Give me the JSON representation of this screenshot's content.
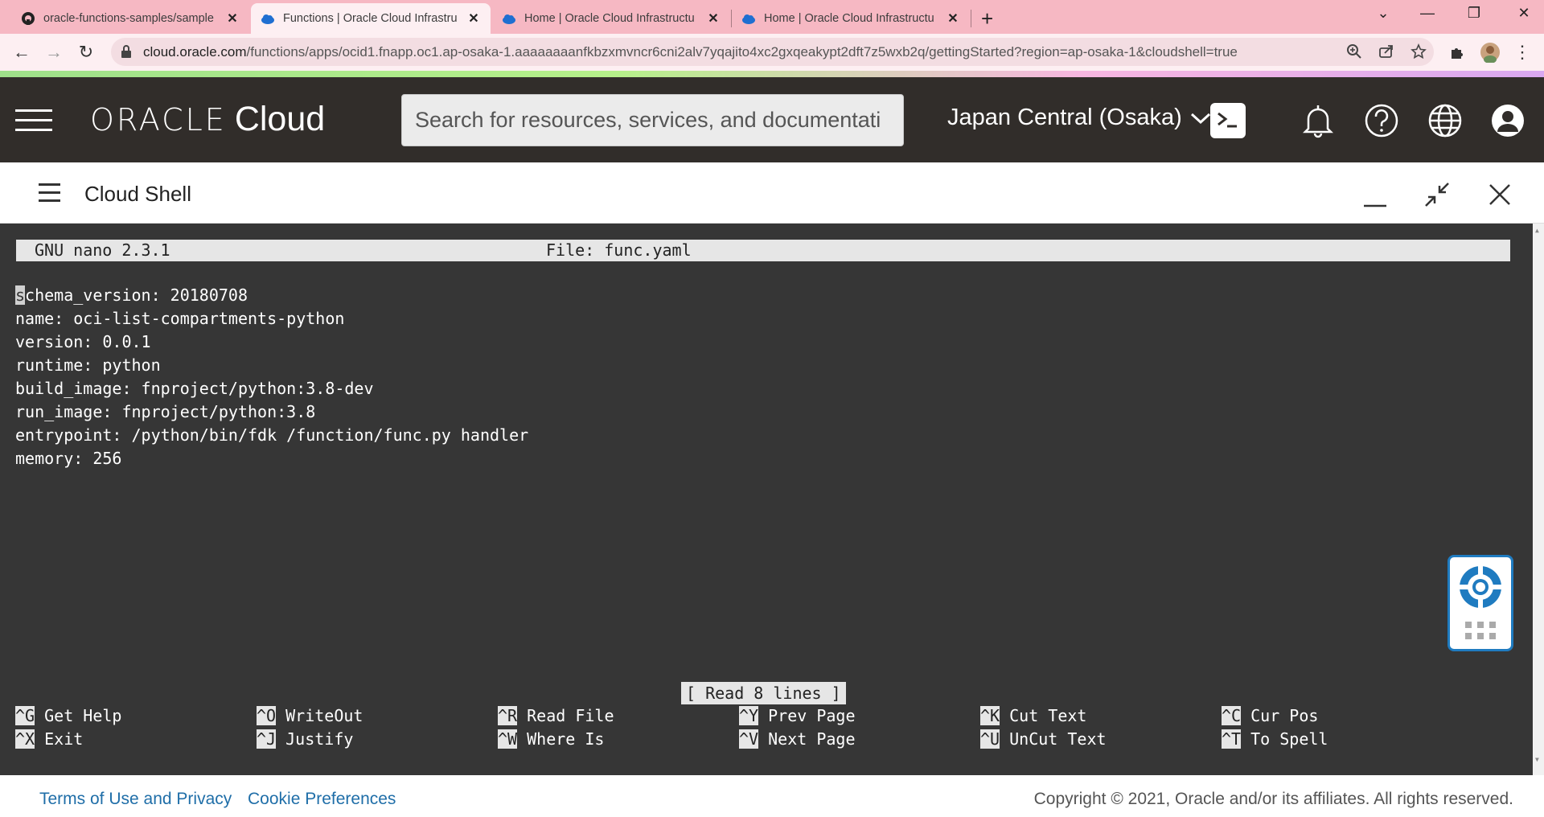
{
  "browser": {
    "tabs": [
      {
        "title": "oracle-functions-samples/sample",
        "icon": "github-icon",
        "active": false
      },
      {
        "title": "Functions | Oracle Cloud Infrastru",
        "icon": "oracle-cloud-icon",
        "active": true
      },
      {
        "title": "Home | Oracle Cloud Infrastructu",
        "icon": "oracle-cloud-icon",
        "active": false
      },
      {
        "title": "Home | Oracle Cloud Infrastructu",
        "icon": "oracle-cloud-icon",
        "active": false
      }
    ],
    "url_host": "cloud.oracle.com",
    "url_path": "/functions/apps/ocid1.fnapp.oc1.ap-osaka-1.aaaaaaaanfkbzxmvncr6cni2alv7yqajito4xc2gxqeakypt2dft7z5wxb2q/gettingStarted?region=ap-osaka-1&cloudshell=true"
  },
  "oracle_header": {
    "logo_oracle": "ORACLE",
    "logo_cloud": "Cloud",
    "search_placeholder": "Search for resources, services, and documentati",
    "region": "Japan Central (Osaka)"
  },
  "cloud_shell": {
    "title": "Cloud Shell"
  },
  "nano": {
    "version": "GNU nano 2.3.1",
    "file": "File: func.yaml",
    "first_char": "s",
    "lines": [
      "chema_version: 20180708",
      "name: oci-list-compartments-python",
      "version: 0.0.1",
      "runtime: python",
      "build_image: fnproject/python:3.8-dev",
      "run_image: fnproject/python:3.8",
      "entrypoint: /python/bin/fdk /function/func.py handler",
      "memory: 256"
    ],
    "status": "[ Read 8 lines ]",
    "shortcuts": [
      {
        "key": "^G",
        "label": "Get Help"
      },
      {
        "key": "^O",
        "label": "WriteOut"
      },
      {
        "key": "^R",
        "label": "Read File"
      },
      {
        "key": "^Y",
        "label": "Prev Page"
      },
      {
        "key": "^K",
        "label": "Cut Text"
      },
      {
        "key": "^C",
        "label": "Cur Pos"
      },
      {
        "key": "^X",
        "label": "Exit"
      },
      {
        "key": "^J",
        "label": "Justify"
      },
      {
        "key": "^W",
        "label": "Where Is"
      },
      {
        "key": "^V",
        "label": "Next Page"
      },
      {
        "key": "^U",
        "label": "UnCut Text"
      },
      {
        "key": "^T",
        "label": "To Spell"
      }
    ]
  },
  "footer": {
    "terms": "Terms of Use and Privacy",
    "cookies": "Cookie Preferences",
    "copyright": "Copyright © 2021, Oracle and/or its affiliates. All rights reserved."
  },
  "colors": {
    "header_bg": "#312d2a",
    "terminal_bg": "#363636",
    "tabstrip_bg": "#f6b8c3",
    "link": "#1f6ea8"
  }
}
